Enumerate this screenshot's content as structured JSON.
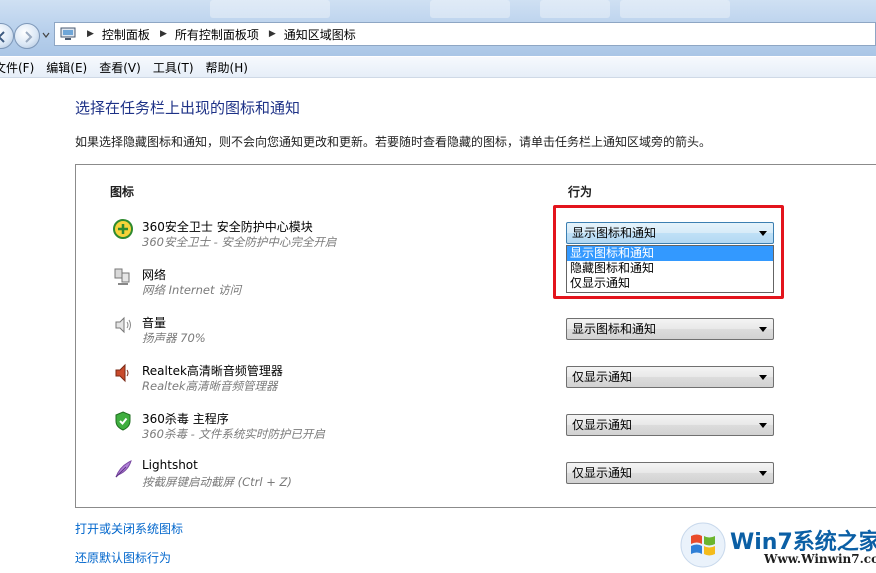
{
  "breadcrumb": [
    "控制面板",
    "所有控制面板项",
    "通知区域图标"
  ],
  "menu": [
    "文件(F)",
    "编辑(E)",
    "查看(V)",
    "工具(T)",
    "帮助(H)"
  ],
  "heading": "选择在任务栏上出现的图标和通知",
  "description": "如果选择隐藏图标和通知，则不会向您通知更改和更新。若要随时查看隐藏的图标，请单击任务栏上通知区域旁的箭头。",
  "columns": {
    "icon": "图标",
    "behavior": "行为"
  },
  "rows": [
    {
      "name": "360安全卫士 安全防护中心模块",
      "sub": "360安全卫士 - 安全防护中心完全开启",
      "behavior": "显示图标和通知",
      "icon": "360-safe-icon"
    },
    {
      "name": "网络",
      "sub": "网络 Internet 访问",
      "behavior": "",
      "icon": "network-icon"
    },
    {
      "name": "音量",
      "sub": "扬声器 70%",
      "behavior": "显示图标和通知",
      "icon": "volume-icon"
    },
    {
      "name": "Realtek高清晰音频管理器",
      "sub": "Realtek高清晰音频管理器",
      "behavior": "仅显示通知",
      "icon": "speaker-icon"
    },
    {
      "name": "360杀毒 主程序",
      "sub": "360杀毒 - 文件系统实时防护已开启",
      "behavior": "仅显示通知",
      "icon": "shield-icon"
    },
    {
      "name": "Lightshot",
      "sub": "按截屏键启动截屏 (Ctrl + Z)",
      "behavior": "仅显示通知",
      "icon": "feather-icon"
    }
  ],
  "dropdown_options": [
    "显示图标和通知",
    "隐藏图标和通知",
    "仅显示通知"
  ],
  "dropdown_selected": "显示图标和通知",
  "links": {
    "system_icons": "打开或关闭系统图标",
    "restore_default": "还原默认图标行为"
  },
  "watermark": {
    "brand": "Win7系统之家",
    "url": "Www.Winwin7.com"
  },
  "colors": {
    "highlight": "#e3141c",
    "link": "#0066cc",
    "heading": "#1e3287",
    "selection": "#3399ff"
  }
}
